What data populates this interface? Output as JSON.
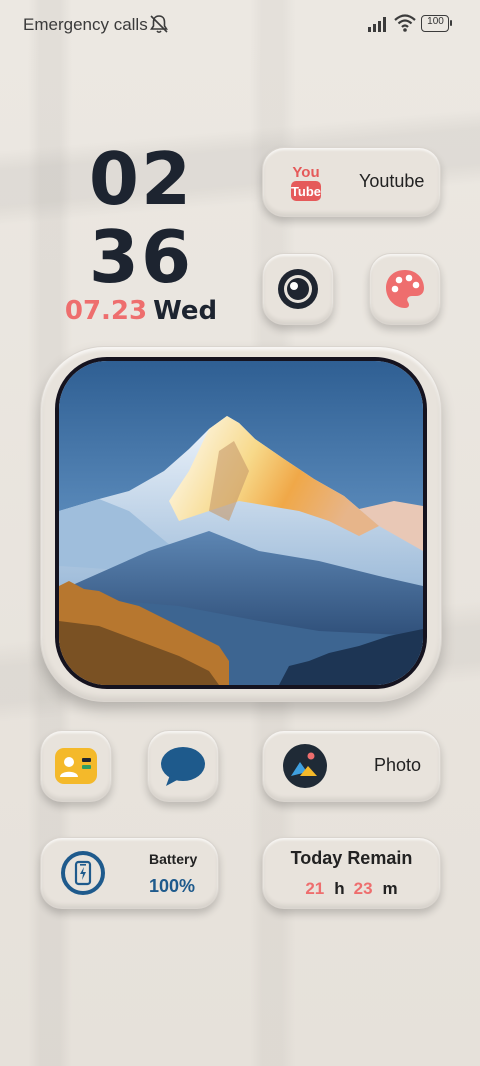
{
  "status_bar": {
    "carrier_text": "Emergency calls",
    "battery_level": "100"
  },
  "clock": {
    "hour": "02",
    "minute": "36",
    "date": "07.23",
    "weekday": "Wed"
  },
  "widgets": {
    "youtube": {
      "logo_top": "You",
      "logo_bottom": "Tube",
      "label": "Youtube"
    },
    "photo": {
      "label": "Photo"
    },
    "battery": {
      "title": "Battery",
      "value": "100%"
    },
    "today_remain": {
      "title": "Today Remain",
      "hours": "21",
      "hours_unit": "h",
      "minutes": "23",
      "minutes_unit": "m"
    }
  },
  "icons": [
    "bell-off-icon",
    "signal-icon",
    "wifi-icon",
    "battery-icon",
    "youtube-icon",
    "camera-icon",
    "palette-icon",
    "contacts-icon",
    "message-icon",
    "gallery-icon",
    "phone-battery-icon"
  ],
  "colors": {
    "accent_red": "#ee6e6e",
    "clock_dark": "#1d2430",
    "battery_blue": "#1e5a8c",
    "background": "#e9e4dd"
  }
}
